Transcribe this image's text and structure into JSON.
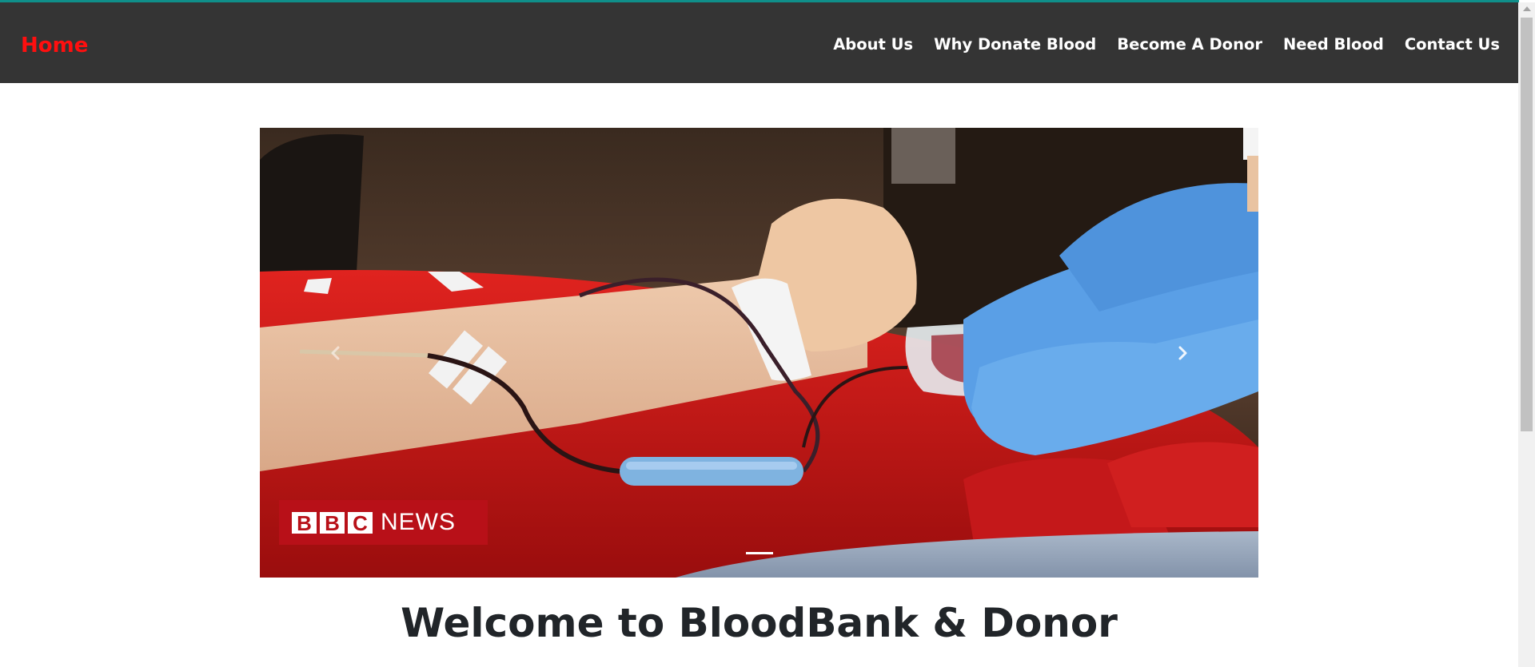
{
  "navbar": {
    "brand": "Home",
    "links": [
      "About Us",
      "Why Donate Blood",
      "Become A Donor",
      "Need Blood",
      "Contact Us"
    ]
  },
  "carousel": {
    "logo_letters": [
      "B",
      "B",
      "C"
    ],
    "logo_text": "NEWS",
    "slide_count": 1,
    "active_index": 0
  },
  "main": {
    "welcome": "Welcome to BloodBank & Donor"
  },
  "colors": {
    "brand": "#ff0f0f",
    "navbar_bg": "#343434",
    "accent_line": "#0f8f8a",
    "bbc_red": "#b81018"
  }
}
